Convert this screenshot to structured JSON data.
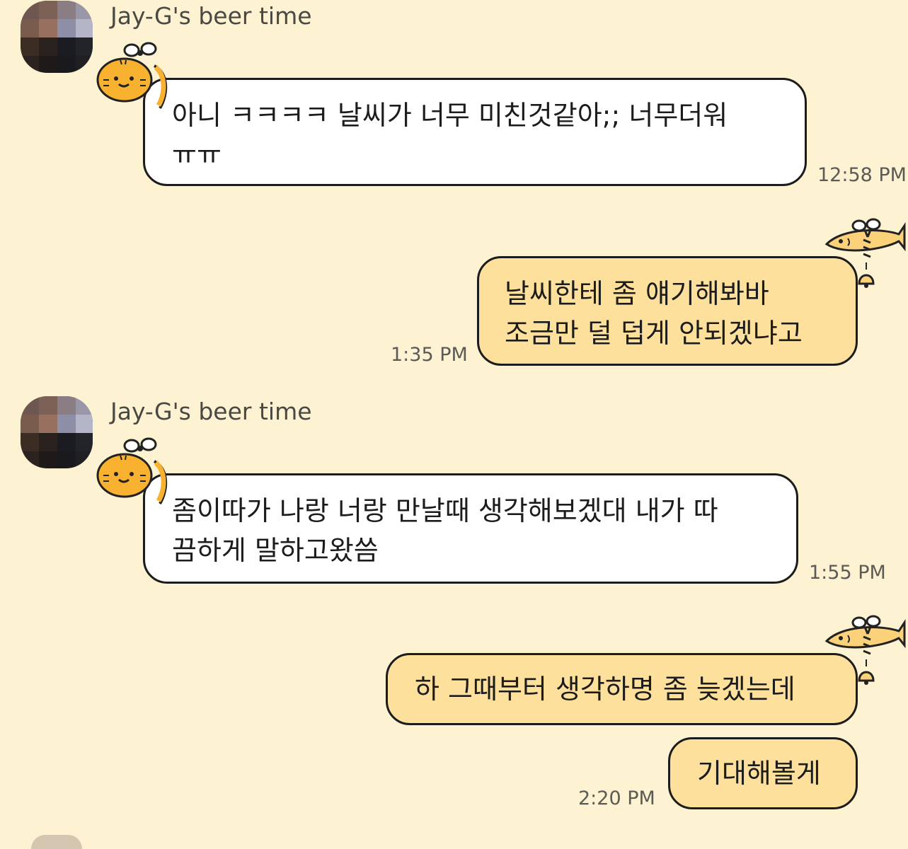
{
  "messages": [
    {
      "direction": "incoming",
      "sender": "Jay-G's beer time",
      "text": "아니 ㅋㅋㅋㅋ 날씨가 너무 미친것같아;; 너무더워\nㅠㅠ",
      "time": "12:58 PM"
    },
    {
      "direction": "outgoing",
      "text": "날씨한테 좀 얘기해봐바\n조금만 덜 덥게 안되겠냐고",
      "time": "1:35 PM"
    },
    {
      "direction": "incoming",
      "sender": "Jay-G's beer time",
      "text": "좀이따가 나랑 너랑 만날때 생각해보겠대 내가 따\n끔하게 말하고왔씀",
      "time": "1:55 PM"
    },
    {
      "direction": "outgoing",
      "text": "하 그때부터 생각하명 좀 늦겠는데",
      "time": ""
    },
    {
      "direction": "outgoing",
      "text": "기대해볼게",
      "time": "2:20 PM"
    }
  ],
  "icons": {
    "incoming_sticker": "tiger-with-ribbon-sticker",
    "outgoing_sticker": "fish-with-bell-sticker",
    "avatar": "pixelated-profile-avatar"
  },
  "colors": {
    "background": "#fdf2d2",
    "incoming_bubble": "#ffffff",
    "outgoing_bubble": "#fde09b",
    "bubble_border": "#1c1c1c"
  }
}
